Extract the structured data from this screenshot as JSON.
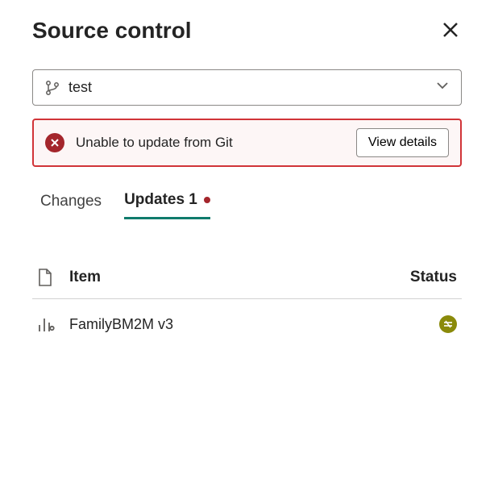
{
  "header": {
    "title": "Source control"
  },
  "branch": {
    "name": "test"
  },
  "alert": {
    "message": "Unable to update from Git",
    "button_label": "View details"
  },
  "tabs": {
    "changes_label": "Changes",
    "updates_label": "Updates 1"
  },
  "list": {
    "item_header": "Item",
    "status_header": "Status",
    "rows": [
      {
        "name": "FamilyBM2M v3"
      }
    ]
  }
}
